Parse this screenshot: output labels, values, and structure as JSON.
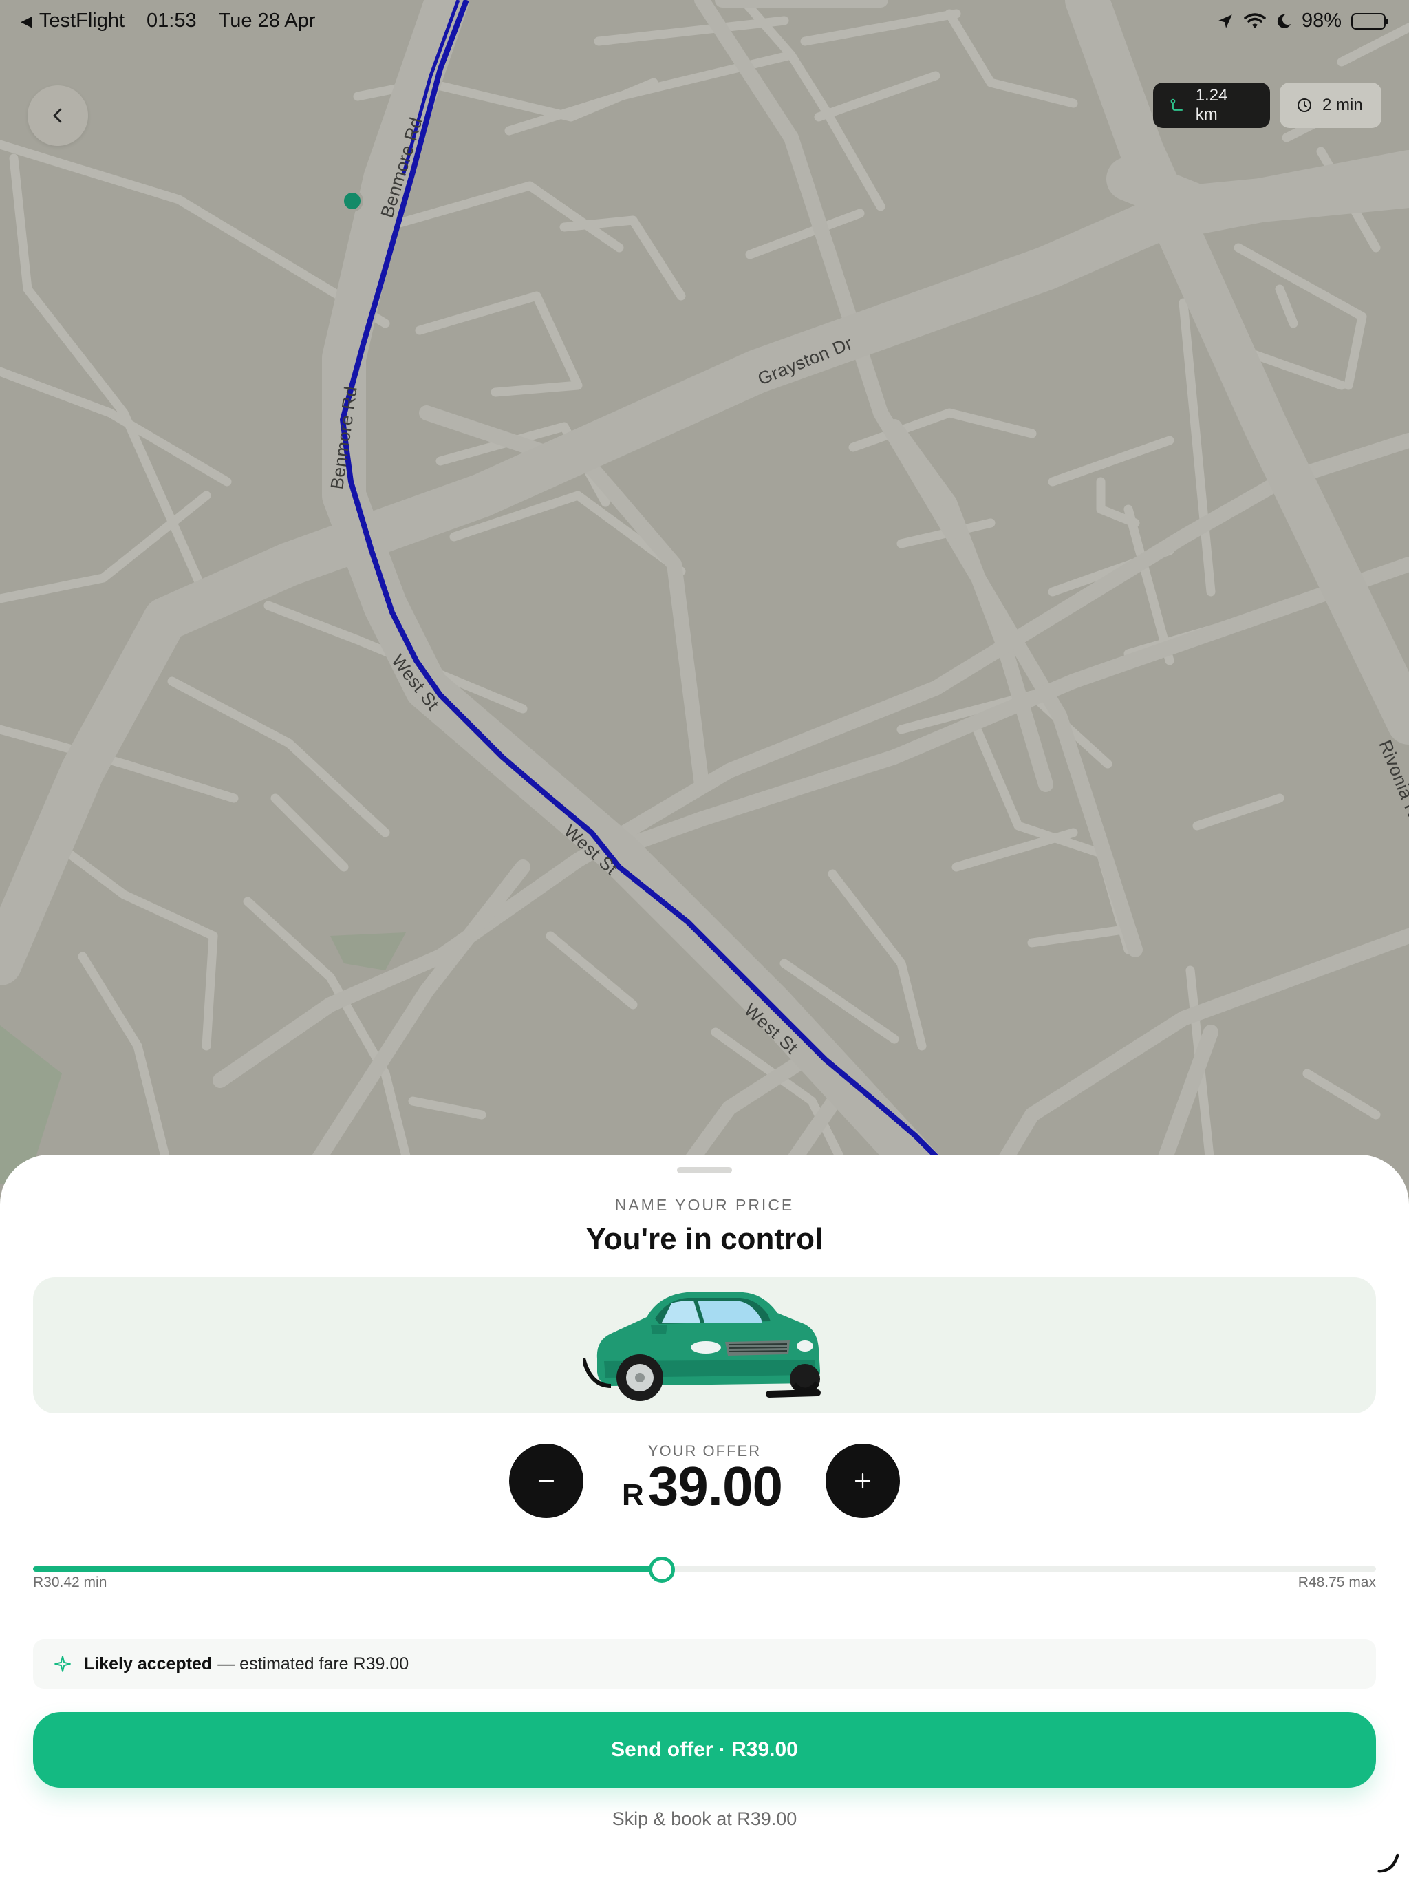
{
  "statusbar": {
    "back_app": "TestFlight",
    "time": "01:53",
    "date": "Tue 28 Apr",
    "battery": "98%"
  },
  "map": {
    "roads": [
      {
        "name": "Benmore Rd",
        "label": "Benmore Rd"
      },
      {
        "name": "Benmore Rd 2",
        "label": "Benmore Rd"
      },
      {
        "name": "Grayston Dr",
        "label": "Grayston Dr"
      },
      {
        "name": "West St",
        "label": "West St"
      },
      {
        "name": "West St 2",
        "label": "West St"
      },
      {
        "name": "West St 3",
        "label": "West St"
      },
      {
        "name": "Rivonia",
        "label": "Rivonia R"
      }
    ],
    "route_color": "#1414a8",
    "distance_chip": "1.24 km",
    "time_chip": "2 min"
  },
  "sheet": {
    "eyebrow": "NAME YOUR PRICE",
    "title": "You're in control",
    "offer_label": "YOUR OFFER",
    "currency": "R",
    "offer_value": "39.00",
    "slider": {
      "min_label": "R30.42 min",
      "max_label": "R48.75 max",
      "min": 30.42,
      "max": 48.75,
      "value": 39.0
    },
    "hint_strong": "Likely accepted",
    "hint_rest": "— estimated fare R39.00",
    "send_label": "Send offer · R39.00",
    "skip_label": "Skip & book at R39.00",
    "accent_color": "#14ba82"
  },
  "icons": {
    "back": "chevron-left-icon",
    "distance": "route-icon",
    "time": "clock-icon",
    "minus": "minus-icon",
    "plus": "plus-icon",
    "hint": "sparkle-icon",
    "car": "car-illustration"
  }
}
